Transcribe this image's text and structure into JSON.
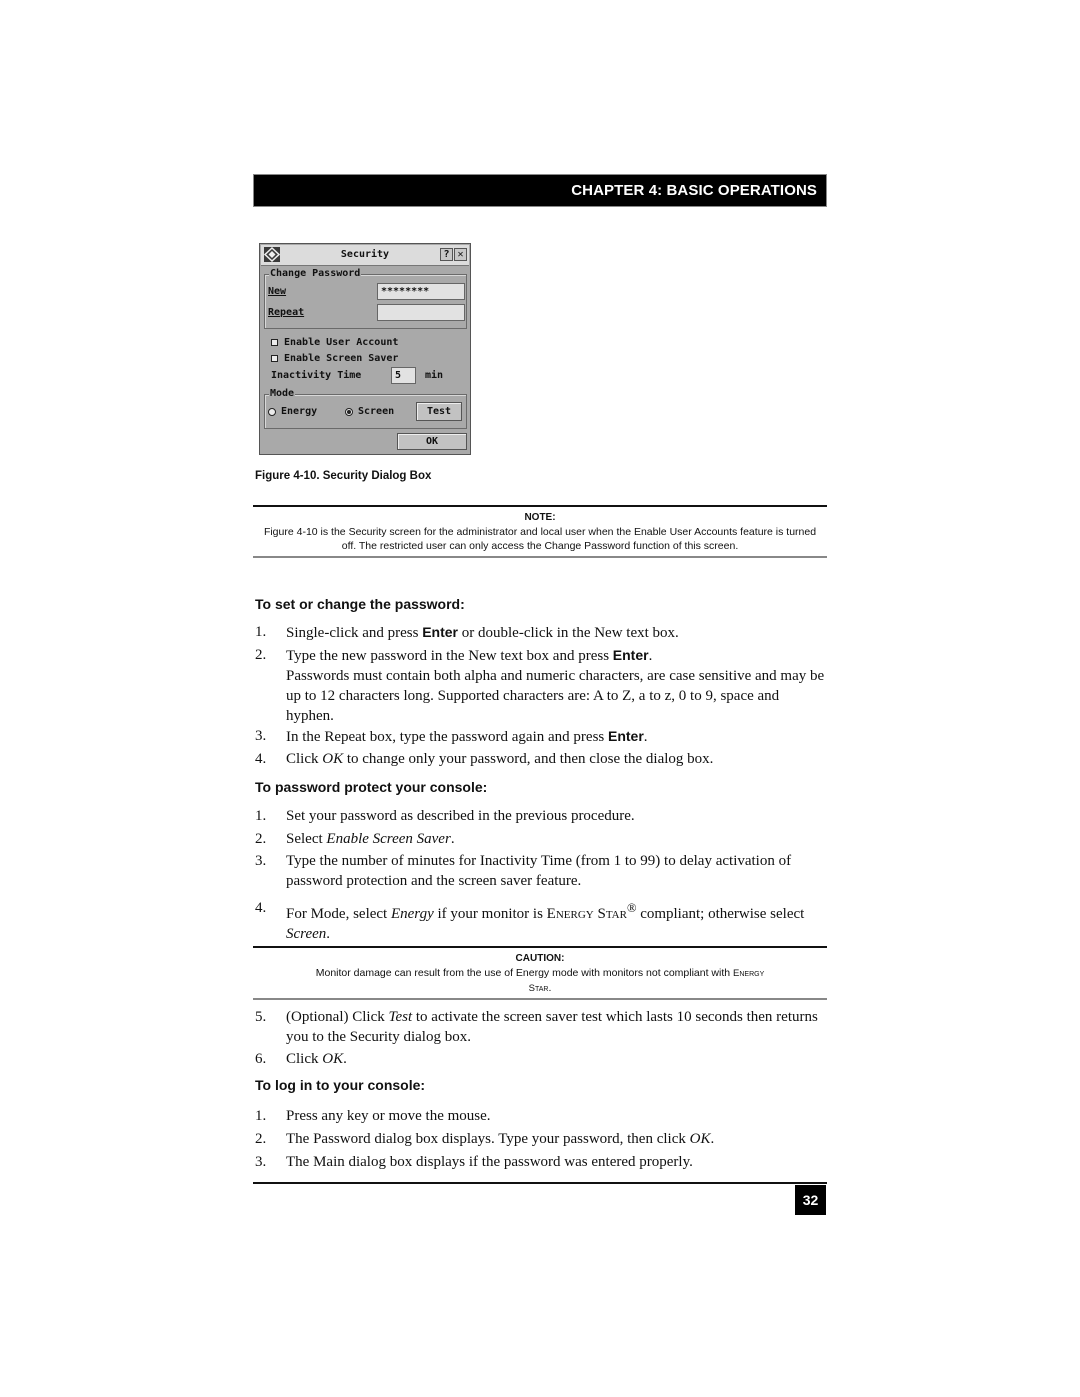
{
  "header": {
    "chapter": "CHAPTER 4: BASIC OPERATIONS"
  },
  "dialog": {
    "title": "Security",
    "help_button": "?",
    "close_button": "✕",
    "change_password_group": "Change Password",
    "new_label": "New",
    "new_value": "********",
    "repeat_label": "Repeat",
    "repeat_value": "",
    "enable_user_account": {
      "label": "Enable User Account",
      "checked": false
    },
    "enable_screen_saver": {
      "label": "Enable Screen Saver",
      "checked": false
    },
    "inactivity_label": "Inactivity Time",
    "inactivity_value": "5",
    "inactivity_unit": "min",
    "mode_group": "Mode",
    "mode_energy": {
      "label": "Energy",
      "selected": false
    },
    "mode_screen": {
      "label": "Screen",
      "selected": true
    },
    "test_button": "Test",
    "ok_button": "OK"
  },
  "figure_caption": "Figure 4-10.  Security Dialog Box",
  "note": {
    "heading": "NOTE:",
    "text": "Figure 4-10 is the Security screen for the administrator and local user when the Enable User Accounts feature is turned off. The restricted user can only access the Change Password function of this screen."
  },
  "section_set_password": {
    "heading": "To set or change the password:",
    "steps": [
      {
        "num": "1.",
        "pre": "Single-click and press ",
        "key": "Enter",
        "post": " or double-click in the New text box."
      },
      {
        "num": "2.",
        "pre": "Type the new password in the New text box and press ",
        "key": "Enter",
        "post": ".",
        "detail": "Passwords must contain both alpha and numeric characters, are case sensitive and may be up to 12 characters long. Supported characters are: A to Z, a to z, 0 to 9, space and hyphen."
      },
      {
        "num": "3.",
        "pre": "In the Repeat box, type the password again and press ",
        "key": "Enter",
        "post": "."
      },
      {
        "num": "4.",
        "pre": "Click ",
        "em": "OK",
        "post": " to change only your password, and then close the dialog box."
      }
    ]
  },
  "section_protect_console": {
    "heading": "To password protect your console:",
    "steps": [
      {
        "num": "1.",
        "text": "Set your password as described in the previous procedure."
      },
      {
        "num": "2.",
        "pre": "Select ",
        "em": "Enable Screen Saver",
        "post": "."
      },
      {
        "num": "3.",
        "text": "Type the number of minutes for Inactivity Time (from 1 to 99) to delay activation of password protection and the screen saver feature."
      },
      {
        "num": "4.",
        "pre": "For Mode, select ",
        "em": "Energy",
        "mid": " if your monitor is ",
        "sc": "Energy Star",
        "sup": "®",
        "post": " compliant; otherwise select ",
        "em2": "Screen",
        "post2": "."
      }
    ]
  },
  "caution": {
    "heading": "CAUTION:",
    "text": "Monitor damage can result from the use of Energy mode with monitors not compliant with",
    "text_sc": "Energy Star",
    "text_end": "."
  },
  "section_protect_console_cont": {
    "steps": [
      {
        "num": "5.",
        "pre": "(Optional) Click ",
        "em": "Test",
        "post": " to activate the screen saver test which lasts 10 seconds then returns you to the Security dialog box."
      },
      {
        "num": "6.",
        "pre": "Click ",
        "em": "OK",
        "post": "."
      }
    ]
  },
  "section_login": {
    "heading": "To log in to your console:",
    "steps": [
      {
        "num": "1.",
        "text": "Press any key or move the mouse."
      },
      {
        "num": "2.",
        "pre": "The Password dialog box displays. Type your password, then click ",
        "em": "OK",
        "post": "."
      },
      {
        "num": "3.",
        "text": "The Main dialog box displays if the password was entered properly."
      }
    ]
  },
  "page_number": "32"
}
